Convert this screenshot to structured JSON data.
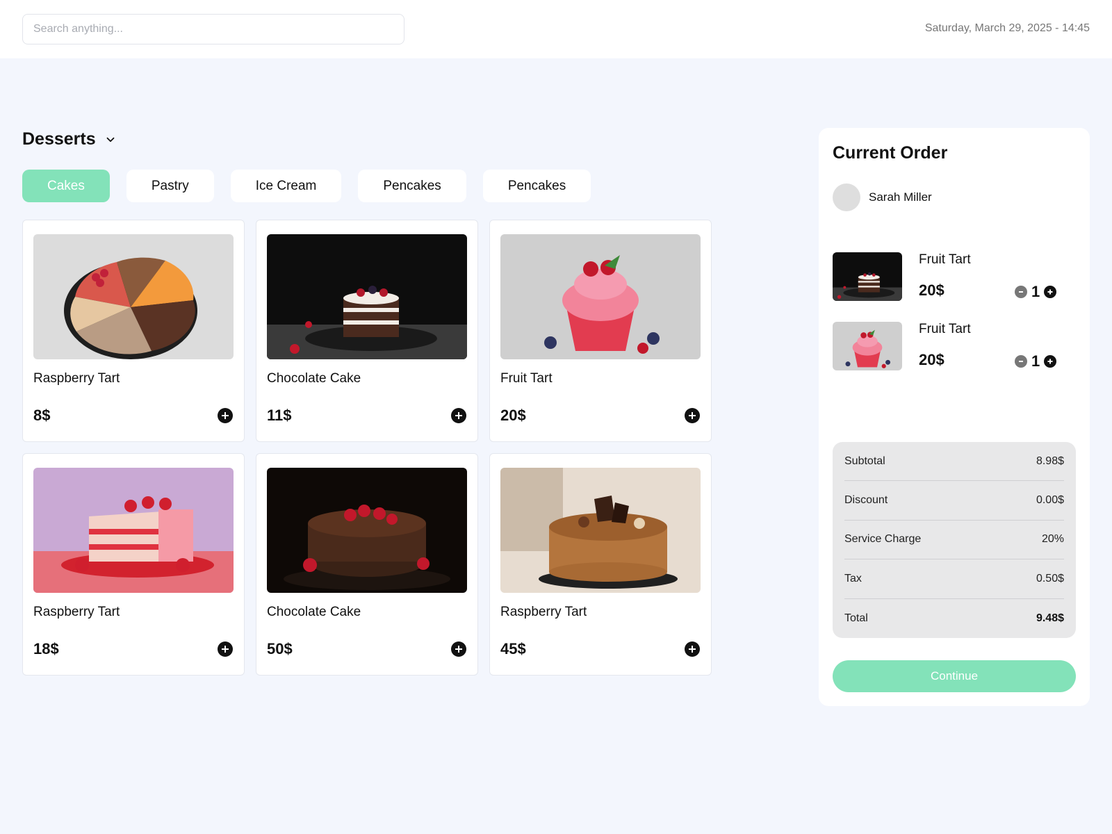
{
  "search": {
    "placeholder": "Search anything..."
  },
  "datetime": "Saturday, March 29, 2025 - 14:45",
  "category": {
    "title": "Desserts",
    "icon": "chevron-down-icon"
  },
  "tabs": [
    {
      "label": "Cakes",
      "active": true
    },
    {
      "label": "Pastry",
      "active": false
    },
    {
      "label": "Ice Cream",
      "active": false
    },
    {
      "label": "Pencakes",
      "active": false
    },
    {
      "label": "Pencakes",
      "active": false
    }
  ],
  "products": [
    {
      "name": "Raspberry Tart",
      "price": "8$",
      "image": "cake-slices-platter"
    },
    {
      "name": "Chocolate Cake",
      "price": "11$",
      "image": "chocolate-layer-cake"
    },
    {
      "name": "Fruit Tart",
      "price": "20$",
      "image": "berry-cupcake"
    },
    {
      "name": "Raspberry Tart",
      "price": "18$",
      "image": "strawberry-cake-slice"
    },
    {
      "name": "Chocolate Cake",
      "price": "50$",
      "image": "chocolate-drip-cake"
    },
    {
      "name": "Raspberry Tart",
      "price": "45$",
      "image": "chocolate-crumb-cake"
    }
  ],
  "order": {
    "title": "Current Order",
    "customer": "Sarah Miller",
    "items": [
      {
        "name": "Fruit Tart",
        "price": "20$",
        "qty": "1",
        "image": "chocolate-layer-cake"
      },
      {
        "name": "Fruit Tart",
        "price": "20$",
        "qty": "1",
        "image": "berry-cupcake"
      }
    ],
    "summary": [
      {
        "label": "Subtotal",
        "value": "8.98$"
      },
      {
        "label": "Discount",
        "value": "0.00$"
      },
      {
        "label": "Service Charge",
        "value": "20%"
      },
      {
        "label": "Tax",
        "value": "0.50$"
      },
      {
        "label": "Total",
        "value": "9.48$"
      }
    ],
    "continue_label": "Continue"
  },
  "colors": {
    "accent": "#83e2b9",
    "background": "#f3f6fd",
    "card": "#ffffff",
    "summary_bg": "#e8e8e9"
  }
}
